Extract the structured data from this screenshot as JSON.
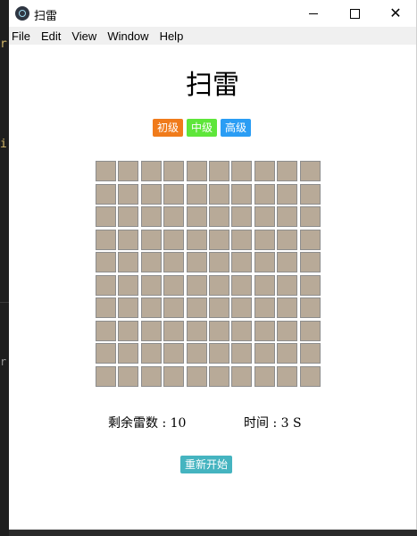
{
  "window": {
    "title": "扫雷"
  },
  "menu": [
    {
      "label": "File"
    },
    {
      "label": "Edit"
    },
    {
      "label": "View"
    },
    {
      "label": "Window"
    },
    {
      "label": "Help"
    }
  ],
  "game": {
    "title": "扫雷",
    "levels": [
      {
        "label": "初级",
        "color": "#f07b1b"
      },
      {
        "label": "中级",
        "color": "#5ee63a"
      },
      {
        "label": "高级",
        "color": "#2a9df4"
      }
    ],
    "board": {
      "rows": 10,
      "cols": 10,
      "cell_color": "#b8aa98",
      "state": "all-covered"
    },
    "status": {
      "mines_left_label": "剩余雷数",
      "mines_left_value": "10",
      "time_label": "时间",
      "time_value": "3",
      "time_unit": "S"
    },
    "restart_label": "重新开始"
  }
}
